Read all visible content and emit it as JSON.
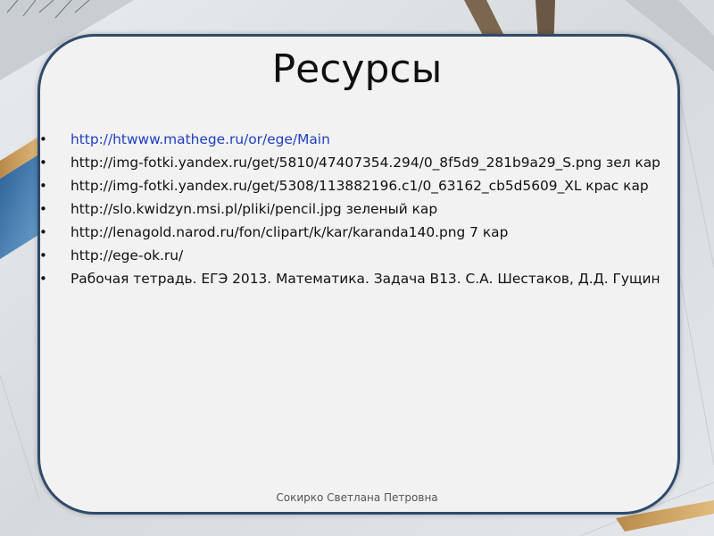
{
  "slide": {
    "title": "Ресурсы",
    "items": [
      {
        "text": "http://htwww.mathege.ru/or/ege/Main",
        "is_link": true
      },
      {
        "text": "http://img-fotki.yandex.ru/get/5810/47407354.294/0_8f5d9_281b9a29_S.png зел кар",
        "is_link": false
      },
      {
        "text": "http://img-fotki.yandex.ru/get/5308/113882196.c1/0_63162_cb5d5609_XL крас кар",
        "is_link": false
      },
      {
        "text": "http://slo.kwidzyn.msi.pl/pliki/pencil.jpg зеленый кар",
        "is_link": false
      },
      {
        "text": "http://lenagold.narod.ru/fon/clipart/k/kar/karanda140.png  7 кар",
        "is_link": false
      },
      {
        "text": "http://ege-ok.ru/",
        "is_link": false
      },
      {
        "text": "Рабочая тетрадь. ЕГЭ 2013. Математика. Задача В13. С.А. Шестаков, Д.Д. Гущин",
        "is_link": false
      }
    ],
    "bullet_char": "•",
    "footer": "Сокирко Светлана Петровна"
  },
  "colors": {
    "card_border": "#2f4a6b",
    "card_fill": "#f2f2f2",
    "link": "#1f3fbf"
  }
}
